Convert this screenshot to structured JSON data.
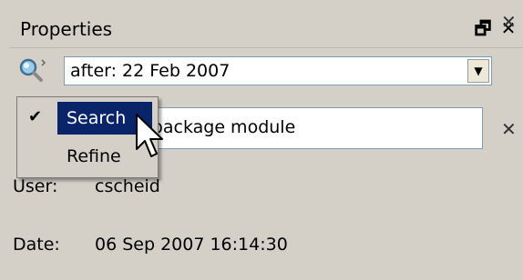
{
  "panel": {
    "title": "Properties",
    "float_icon": "float-window-icon",
    "close_icon": "close-icon",
    "float_glyph": "🗗",
    "close_glyph": "✕"
  },
  "search": {
    "icon": "search-magnifier-icon",
    "value": "after: 22 Feb 2007",
    "dropdown_glyph": "▼",
    "clear_glyph": "✕"
  },
  "comment": {
    "visible_text": "een with package module",
    "clear_glyph": "✕"
  },
  "fields": [
    {
      "label": "User:",
      "value": "cscheid"
    },
    {
      "label": "Date:",
      "value": "06 Sep 2007 16:14:30"
    }
  ],
  "menu": {
    "items": [
      {
        "label": "Search",
        "checked": true,
        "selected": true,
        "check_glyph": "✔"
      },
      {
        "label": "Refine",
        "checked": false,
        "selected": false
      }
    ]
  },
  "colors": {
    "background": "#d4d0c8",
    "selection": "#0a246a",
    "input_border": "#7f9db9"
  }
}
